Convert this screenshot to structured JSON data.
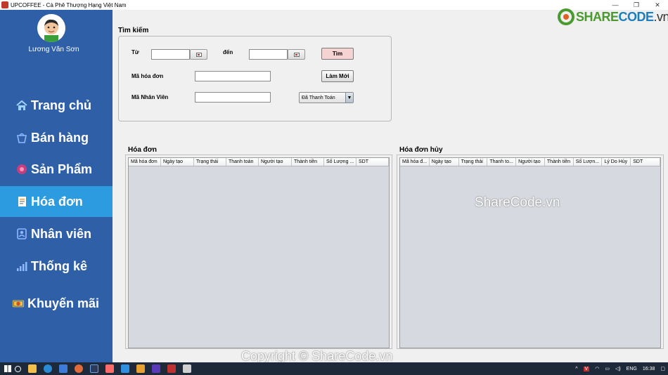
{
  "window": {
    "title": "UPCOFFEE - Cà Phê Thượng Hạng Việt Nam",
    "controls": [
      "—",
      "❐",
      "✕"
    ]
  },
  "sidebar": {
    "username": "Lương Văn Sơn",
    "items": [
      {
        "label": "Trang chủ",
        "icon": "home-icon"
      },
      {
        "label": "Bán hàng",
        "icon": "basket-icon"
      },
      {
        "label": "Sản Phẩm",
        "icon": "product-icon"
      },
      {
        "label": "Hóa đơn",
        "icon": "invoice-icon",
        "active": true
      },
      {
        "label": "Nhân viên",
        "icon": "employee-icon"
      },
      {
        "label": "Thống kê",
        "icon": "chart-icon"
      },
      {
        "label": "Khuyến mãi",
        "icon": "coupon-icon"
      }
    ]
  },
  "search": {
    "title": "Tìm kiếm",
    "from_label": "Từ",
    "to_label": "đến",
    "search_button": "Tìm",
    "invoice_id_label": "Mã hóa đơn",
    "refresh_button": "Làm Mới",
    "employee_id_label": "Mã Nhân Viên",
    "status_selected": "Đã Thanh Toán"
  },
  "invoices": {
    "title": "Hóa đơn",
    "columns": [
      "Mã hóa đơn",
      "Ngày tạo",
      "Trạng thái",
      "Thanh toán",
      "Người tạo",
      "Thành tiền",
      "Số Lượng ...",
      "SDT"
    ]
  },
  "cancelled": {
    "title": "Hóa đơn hủy",
    "columns": [
      "Mã hóa đ...",
      "Ngày tạo",
      "Trạng thái",
      "Thanh to...",
      "Người tạo",
      "Thành tiền",
      "Số Lượn...",
      "Lý Do Hủy",
      "SDT"
    ]
  },
  "watermarks": {
    "center": "ShareCode.vn",
    "bottom": "Copyright © ShareCode.vn"
  },
  "logo": {
    "part1": "SHARE",
    "part2": "CODE",
    "part3": ".vn"
  },
  "taskbar": {
    "language": "ENG",
    "time": "16:38"
  },
  "colors": {
    "sidebar": "#2f5fa7",
    "active_item": "#2c9be0",
    "search_button": "#f5d3d3",
    "table_bg": "#d6d9df"
  }
}
